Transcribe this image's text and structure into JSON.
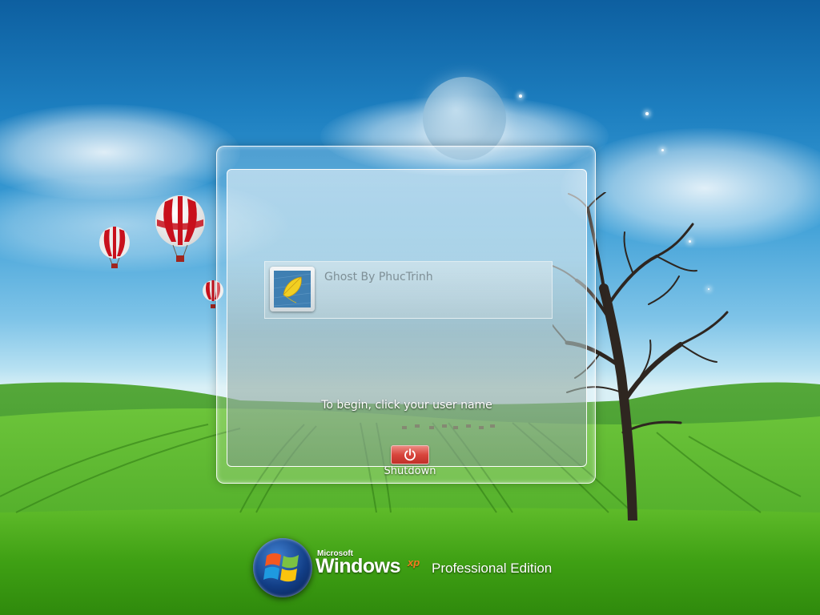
{
  "login": {
    "user_name": "Ghost By PhucTrinh",
    "instruction": "To begin, click your user name",
    "shutdown_label": "Shutdown"
  },
  "branding": {
    "microsoft": "Microsoft",
    "windows": "Windows",
    "xp": "xp",
    "edition": "Professional Edition"
  },
  "icons": {
    "avatar": "yellow-leaf-icon",
    "shutdown": "power-icon",
    "logo": "windows-flag-icon"
  },
  "colors": {
    "shutdown_red": "#d8453c",
    "xp_orange": "#f47a20",
    "grass_green": "#4fb02a",
    "sky_blue": "#1d7fc0"
  }
}
